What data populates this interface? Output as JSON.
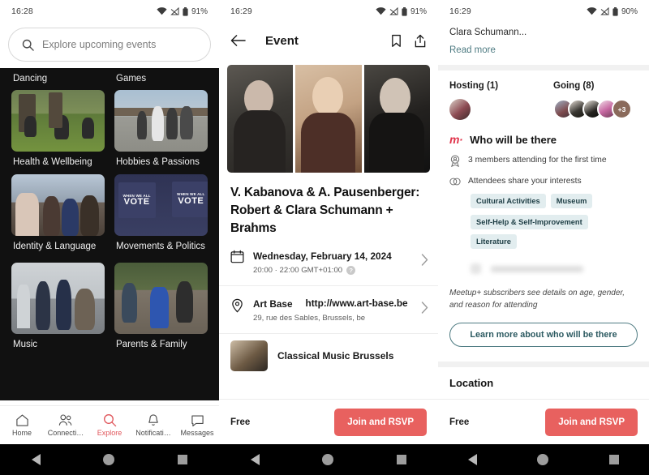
{
  "panel1": {
    "status": {
      "time": "16:28",
      "battery": "91%"
    },
    "search": {
      "placeholder": "Explore upcoming events"
    },
    "categories": [
      {
        "label": "Dancing",
        "photo": "dancing"
      },
      {
        "label": "Games",
        "photo": "games"
      },
      {
        "label": "Health & Wellbeing",
        "photo": "yoga-in-park"
      },
      {
        "label": "Hobbies & Passions",
        "photo": "photographers"
      },
      {
        "label": "Identity & Language",
        "photo": "group-selfie"
      },
      {
        "label": "Movements & Politics",
        "photo": "when-we-all-vote-signs"
      },
      {
        "label": "Music",
        "photo": "street-musicians"
      },
      {
        "label": "Parents & Family",
        "photo": "family-parade"
      }
    ],
    "vote_sign": {
      "line1": "WHEN WE ALL",
      "line2": "VOTE"
    },
    "tabs": [
      {
        "label": "Home",
        "icon": "home-icon",
        "active": false
      },
      {
        "label": "Connecti…",
        "icon": "people-icon",
        "active": false
      },
      {
        "label": "Explore",
        "icon": "search-icon",
        "active": true
      },
      {
        "label": "Notificati…",
        "icon": "bell-icon",
        "active": false
      },
      {
        "label": "Messages",
        "icon": "chat-icon",
        "active": false
      }
    ]
  },
  "panel2": {
    "status": {
      "time": "16:29",
      "battery": "91%"
    },
    "appbar": {
      "title": "Event",
      "back_icon": "arrow-left-icon",
      "save_icon": "bookmark-icon",
      "share_icon": "share-icon"
    },
    "hero_alt": "Clara Schumann, Johannes Brahms and Robert Schumann portraits",
    "title": "V. Kabanova & A. Pausenberger: Robert & Clara Schumann + Brahms",
    "date": {
      "main": "Wednesday, February 14, 2024",
      "sub": "20:00 · 22:00 GMT+01:00",
      "info": "?"
    },
    "venue": {
      "name": "Art Base",
      "url": "http://www.art-base.be",
      "address": "29, rue des Sables, Brussels, be"
    },
    "group": {
      "name": "Classical Music Brussels"
    },
    "footer": {
      "price": "Free",
      "cta": "Join and RSVP"
    }
  },
  "panel3": {
    "status": {
      "time": "16:29",
      "battery": "90%"
    },
    "description_tail": "Clara Schumann...",
    "read_more": "Read more",
    "hosting": {
      "title": "Hosting (1)"
    },
    "going": {
      "title": "Going (8)",
      "overflow": "+3"
    },
    "who": {
      "title": "Who will be there",
      "logo": "meetup-m-logo",
      "first_time": "3 members attending for the first time",
      "interests_label": "Attendees share your interests",
      "interests": [
        "Cultural Activities",
        "Museum",
        "Self-Help & Self-Improvement",
        "Literature"
      ],
      "note": "Meetup+ subscribers see details on age, gender, and reason for attending",
      "learn_more": "Learn more about who will be there"
    },
    "location_title": "Location",
    "footer": {
      "price": "Free",
      "cta": "Join and RSVP"
    }
  },
  "colors": {
    "accent": "#e8615f",
    "teal": "#4e7b82",
    "chip_bg": "#e2edef",
    "meetup_red": "#e0334a"
  }
}
